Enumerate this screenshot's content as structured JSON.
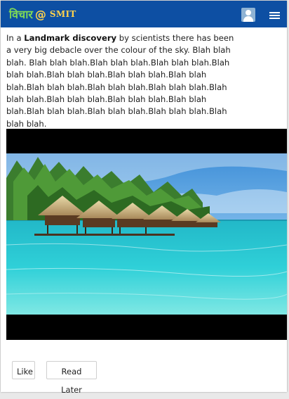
{
  "header": {
    "logo_script": "विचार",
    "logo_at": "@",
    "logo_brand": "SMIT",
    "icons": [
      "user-icon",
      "hamburger-menu-icon"
    ]
  },
  "post": {
    "intro": "In a ",
    "highlight": "Landmark discovery",
    "body": " by scientists there has been a very big debacle over the colour of the sky. Blah blah blah. Blah blah blah.Blah blah blah.Blah blah blah.Blah blah blah.Blah blah blah.Blah blah blah.Blah blah blah.Blah blah blah.Blah blah blah.Blah blah blah.Blah blah blah.Blah blah blah.Blah blah blah.Blah blah blah.Blah blah blah.Blah blah blah.Blah blah blah.Blah blah blah."
  },
  "image": {
    "subject": "tropical beach with overwater bungalows"
  },
  "actions": {
    "like_label": "Like",
    "read_later_label": "Read Later"
  },
  "colors": {
    "header_bg": "#0d4fa3",
    "logo_green": "#7ed957",
    "logo_yellow": "#ffd24d"
  }
}
